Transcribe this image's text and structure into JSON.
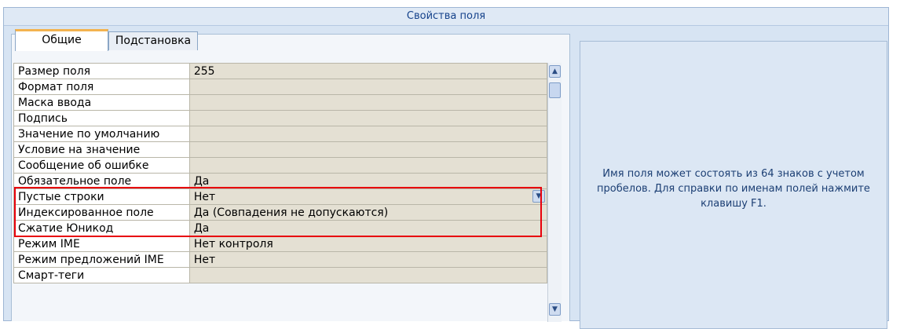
{
  "panel": {
    "title": "Свойства поля"
  },
  "tabs": [
    {
      "label": "Общие",
      "selected": true
    },
    {
      "label": "Подстановка",
      "selected": false
    }
  ],
  "properties": [
    {
      "name": "Размер поля",
      "value": "255"
    },
    {
      "name": "Формат поля",
      "value": ""
    },
    {
      "name": "Маска ввода",
      "value": ""
    },
    {
      "name": "Подпись",
      "value": ""
    },
    {
      "name": "Значение по умолчанию",
      "value": ""
    },
    {
      "name": "Условие на значение",
      "value": ""
    },
    {
      "name": "Сообщение об ошибке",
      "value": ""
    },
    {
      "name": "Обязательное поле",
      "value": "Да"
    },
    {
      "name": "Пустые строки",
      "value": "Нет"
    },
    {
      "name": "Индексированное поле",
      "value": "Да (Совпадения не допускаются)"
    },
    {
      "name": "Сжатие Юникод",
      "value": "Да"
    },
    {
      "name": "Режим IME",
      "value": "Нет контроля"
    },
    {
      "name": "Режим предложений IME",
      "value": "Нет"
    },
    {
      "name": "Смарт-теги",
      "value": ""
    }
  ],
  "help": {
    "text": "Имя поля может состоять из 64 знаков с учетом пробелов.  Для справки по именам полей нажмите клавишу F1."
  },
  "icons": {
    "scroll_up": "arrow-up-icon",
    "scroll_down": "arrow-down-icon",
    "dropdown": "chevron-down-icon"
  },
  "colors": {
    "highlight": "#e8000b",
    "active_tab_accent": "#f3b34f"
  }
}
